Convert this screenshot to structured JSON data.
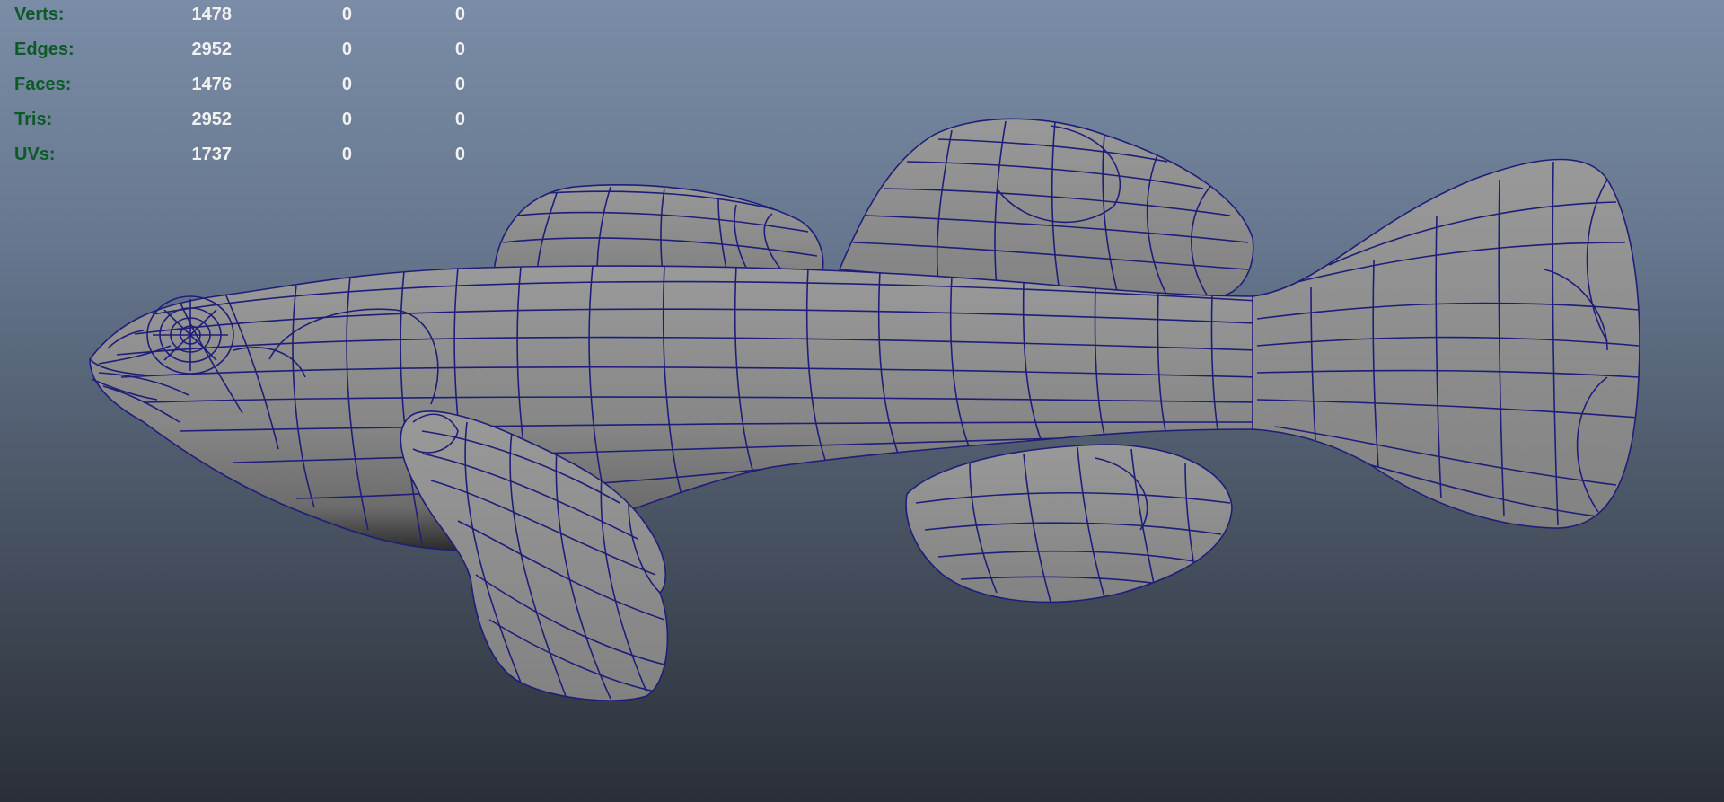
{
  "hud": {
    "rows": [
      {
        "label": "Verts:",
        "values": [
          "1478",
          "0",
          "0"
        ]
      },
      {
        "label": "Edges:",
        "values": [
          "2952",
          "0",
          "0"
        ]
      },
      {
        "label": "Faces:",
        "values": [
          "1476",
          "0",
          "0"
        ]
      },
      {
        "label": "Tris:",
        "values": [
          "2952",
          "0",
          "0"
        ]
      },
      {
        "label": "UVs:",
        "values": [
          "1737",
          "0",
          "0"
        ]
      }
    ]
  },
  "colors": {
    "label": "#0c5a28",
    "value": "#f2f2f2",
    "mesh_fill": "#8c8c8c",
    "wireframe": "#1e1e7a",
    "bg_top": "#7b8ca6",
    "bg_bottom": "#2a2f37"
  },
  "model": {
    "icon": "fish-mesh-icon"
  }
}
